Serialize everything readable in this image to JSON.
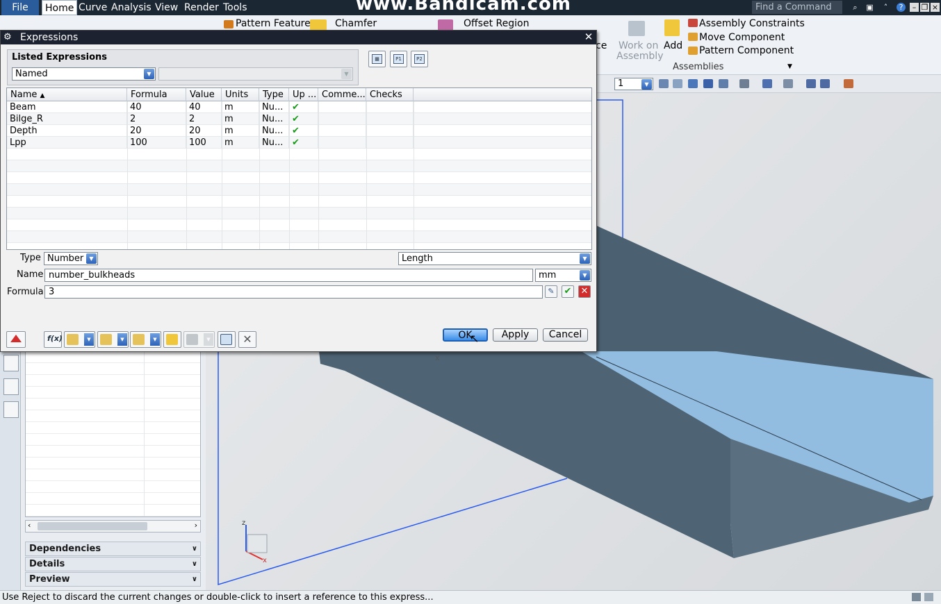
{
  "menubar": {
    "file": "File",
    "tabs": [
      "Home",
      "Curve",
      "Analysis",
      "View",
      "Render",
      "Tools"
    ],
    "watermark": "www.Bandicam.com",
    "find_command": "Find a Command"
  },
  "ribbon": {
    "pattern_feature": "Pattern Feature",
    "chamfer": "Chamfer",
    "offset_region": "Offset Region",
    "ce": "ce",
    "work_on_assembly_line1": "Work on",
    "work_on_assembly_line2": "Assembly",
    "add": "Add",
    "assembly_constraints": "Assembly Constraints",
    "move_component": "Move Component",
    "pattern_component": "Pattern Component",
    "group_assemblies": "Assemblies"
  },
  "toolbar": {
    "selection_value": "1"
  },
  "dialog": {
    "title": "Expressions",
    "listed_expressions_label": "Listed Expressions",
    "listed_filter": "Named",
    "columns": [
      "Name",
      "Formula",
      "Value",
      "Units",
      "Type",
      "Up ...",
      "Comme...",
      "Checks"
    ],
    "rows": [
      {
        "name": "Beam",
        "formula": "40",
        "value": "40",
        "units": "m",
        "type": "Nu...",
        "up": "✔"
      },
      {
        "name": "Bilge_R",
        "formula": "2",
        "value": "2",
        "units": "m",
        "type": "Nu...",
        "up": "✔"
      },
      {
        "name": "Depth",
        "formula": "20",
        "value": "20",
        "units": "m",
        "type": "Nu...",
        "up": "✔"
      },
      {
        "name": "Lpp",
        "formula": "100",
        "value": "100",
        "units": "m",
        "type": "Nu...",
        "up": "✔"
      }
    ],
    "type_label": "Type",
    "type_value": "Number",
    "dimensionality_value": "Length",
    "name_label": "Name",
    "name_value": "number_bulkheads",
    "units_value": "mm",
    "formula_label": "Formula",
    "formula_value": "3",
    "ok": "OK",
    "apply": "Apply",
    "cancel": "Cancel"
  },
  "navigator": {
    "panels": [
      "Dependencies",
      "Details",
      "Preview"
    ]
  },
  "status_bar": {
    "message": "Use Reject to discard the current changes or double-click to insert a reference to this express..."
  },
  "colors": {
    "menubar_bg": "#1c2734",
    "file_bg": "#2a5b9a",
    "model_top": "#8cb4d6",
    "model_side": "#4a5f70",
    "datum_line": "#2a5aee"
  }
}
